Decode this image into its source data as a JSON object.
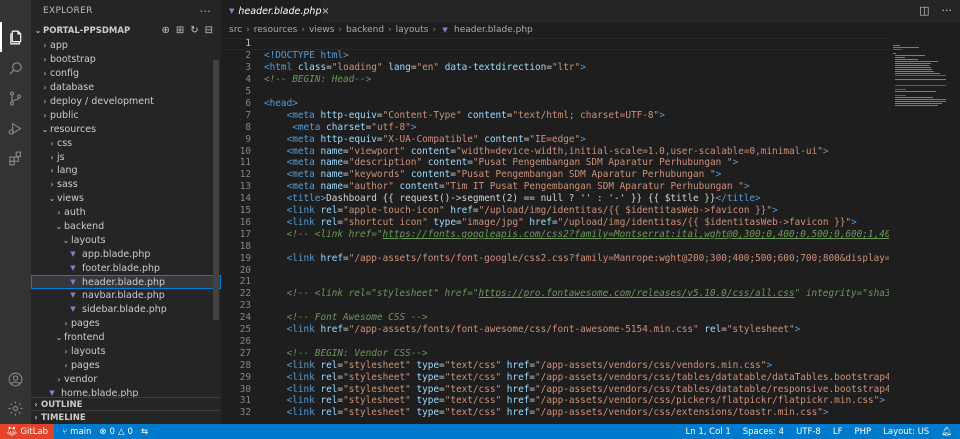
{
  "activity": {
    "items": [
      "files-icon",
      "search-icon",
      "source-control-icon",
      "run-debug-icon",
      "extensions-icon"
    ],
    "bottom": [
      "account-icon",
      "settings-gear-icon"
    ]
  },
  "sidebar": {
    "title": "EXPLORER",
    "project": "PORTAL-PPSDMAP",
    "tree": [
      {
        "label": "app",
        "depth": 1,
        "type": "folder",
        "open": false
      },
      {
        "label": "bootstrap",
        "depth": 1,
        "type": "folder",
        "open": false
      },
      {
        "label": "config",
        "depth": 1,
        "type": "folder",
        "open": false
      },
      {
        "label": "database",
        "depth": 1,
        "type": "folder",
        "open": false
      },
      {
        "label": "deploy / development",
        "depth": 1,
        "type": "folder",
        "open": false
      },
      {
        "label": "public",
        "depth": 1,
        "type": "folder",
        "open": false
      },
      {
        "label": "resources",
        "depth": 1,
        "type": "folder",
        "open": true
      },
      {
        "label": "css",
        "depth": 2,
        "type": "folder",
        "open": false
      },
      {
        "label": "js",
        "depth": 2,
        "type": "folder",
        "open": false
      },
      {
        "label": "lang",
        "depth": 2,
        "type": "folder",
        "open": false
      },
      {
        "label": "sass",
        "depth": 2,
        "type": "folder",
        "open": false
      },
      {
        "label": "views",
        "depth": 2,
        "type": "folder",
        "open": true
      },
      {
        "label": "auth",
        "depth": 3,
        "type": "folder",
        "open": false
      },
      {
        "label": "backend",
        "depth": 3,
        "type": "folder",
        "open": true
      },
      {
        "label": "layouts",
        "depth": 4,
        "type": "folder",
        "open": true
      },
      {
        "label": "app.blade.php",
        "depth": 5,
        "type": "file"
      },
      {
        "label": "footer.blade.php",
        "depth": 5,
        "type": "file"
      },
      {
        "label": "header.blade.php",
        "depth": 5,
        "type": "file",
        "selected": true
      },
      {
        "label": "navbar.blade.php",
        "depth": 5,
        "type": "file"
      },
      {
        "label": "sidebar.blade.php",
        "depth": 5,
        "type": "file"
      },
      {
        "label": "pages",
        "depth": 4,
        "type": "folder",
        "open": false
      },
      {
        "label": "frontend",
        "depth": 3,
        "type": "folder",
        "open": true
      },
      {
        "label": "layouts",
        "depth": 4,
        "type": "folder",
        "open": false
      },
      {
        "label": "pages",
        "depth": 4,
        "type": "folder",
        "open": false
      },
      {
        "label": "vendor",
        "depth": 3,
        "type": "folder",
        "open": false
      },
      {
        "label": "home.blade.php",
        "depth": 2,
        "type": "file"
      }
    ],
    "outline": "OUTLINE",
    "timeline": "TIMELINE"
  },
  "tab": {
    "label": "header.blade.php",
    "close": "×"
  },
  "breadcrumb": [
    "src",
    "resources",
    "views",
    "backend",
    "layouts",
    "header.blade.php"
  ],
  "lines": [
    {
      "n": "1",
      "t": [
        [
          "",
          ""
        ]
      ]
    },
    {
      "n": "2",
      "t": [
        [
          "c-doc",
          "<!DOCTYPE html>"
        ]
      ]
    },
    {
      "n": "3",
      "t": [
        [
          "c-tag",
          "<html"
        ],
        [
          "",
          " "
        ],
        [
          "c-attr",
          "class"
        ],
        [
          "",
          "="
        ],
        [
          "c-str",
          "\"loading\""
        ],
        [
          "",
          " "
        ],
        [
          "c-attr",
          "lang"
        ],
        [
          "",
          "="
        ],
        [
          "c-str",
          "\"en\""
        ],
        [
          "",
          " "
        ],
        [
          "c-attr",
          "data-textdirection"
        ],
        [
          "",
          "="
        ],
        [
          "c-str",
          "\"ltr\""
        ],
        [
          "c-tag",
          ">"
        ]
      ]
    },
    {
      "n": "4",
      "t": [
        [
          "c-com",
          "<!-- BEGIN: Head-->"
        ]
      ]
    },
    {
      "n": "5",
      "t": [
        [
          "",
          ""
        ]
      ]
    },
    {
      "n": "6",
      "t": [
        [
          "c-tag",
          "<head>"
        ]
      ]
    },
    {
      "n": "7",
      "t": [
        [
          "",
          "    "
        ],
        [
          "c-tag",
          "<meta"
        ],
        [
          "",
          " "
        ],
        [
          "c-attr",
          "http-equiv"
        ],
        [
          "",
          "="
        ],
        [
          "c-str",
          "\"Content-Type\""
        ],
        [
          "",
          " "
        ],
        [
          "c-attr",
          "content"
        ],
        [
          "",
          "="
        ],
        [
          "c-str",
          "\"text/html; charset=UTF-8\""
        ],
        [
          "c-tag",
          ">"
        ]
      ]
    },
    {
      "n": "8",
      "t": [
        [
          "",
          "     "
        ],
        [
          "c-tag",
          "<meta"
        ],
        [
          "",
          " "
        ],
        [
          "c-attr",
          "charset"
        ],
        [
          "",
          "="
        ],
        [
          "c-str",
          "\"utf-8\""
        ],
        [
          "c-tag",
          ">"
        ]
      ]
    },
    {
      "n": "9",
      "t": [
        [
          "",
          "    "
        ],
        [
          "c-tag",
          "<meta"
        ],
        [
          "",
          " "
        ],
        [
          "c-attr",
          "http-equiv"
        ],
        [
          "",
          "="
        ],
        [
          "c-str",
          "\"X-UA-Compatible\""
        ],
        [
          "",
          " "
        ],
        [
          "c-attr",
          "content"
        ],
        [
          "",
          "="
        ],
        [
          "c-str",
          "\"IE=edge\""
        ],
        [
          "c-tag",
          ">"
        ]
      ]
    },
    {
      "n": "10",
      "t": [
        [
          "",
          "    "
        ],
        [
          "c-tag",
          "<meta"
        ],
        [
          "",
          " "
        ],
        [
          "c-attr",
          "name"
        ],
        [
          "",
          "="
        ],
        [
          "c-str",
          "\"viewport\""
        ],
        [
          "",
          " "
        ],
        [
          "c-attr",
          "content"
        ],
        [
          "",
          "="
        ],
        [
          "c-str",
          "\"width=device-width,initial-scale=1.0,user-scalable=0,minimal-ui\""
        ],
        [
          "c-tag",
          ">"
        ]
      ]
    },
    {
      "n": "11",
      "t": [
        [
          "",
          "    "
        ],
        [
          "c-tag",
          "<meta"
        ],
        [
          "",
          " "
        ],
        [
          "c-attr",
          "name"
        ],
        [
          "",
          "="
        ],
        [
          "c-str",
          "\"description\""
        ],
        [
          "",
          " "
        ],
        [
          "c-attr",
          "content"
        ],
        [
          "",
          "="
        ],
        [
          "c-str",
          "\"Pusat Pengembangan SDM Aparatur Perhubungan \""
        ],
        [
          "c-tag",
          ">"
        ]
      ]
    },
    {
      "n": "12",
      "t": [
        [
          "",
          "    "
        ],
        [
          "c-tag",
          "<meta"
        ],
        [
          "",
          " "
        ],
        [
          "c-attr",
          "name"
        ],
        [
          "",
          "="
        ],
        [
          "c-str",
          "\"keywords\""
        ],
        [
          "",
          " "
        ],
        [
          "c-attr",
          "content"
        ],
        [
          "",
          "="
        ],
        [
          "c-str",
          "\"Pusat Pengembangan SDM Aparatur Perhubungan \""
        ],
        [
          "c-tag",
          ">"
        ]
      ]
    },
    {
      "n": "13",
      "t": [
        [
          "",
          "    "
        ],
        [
          "c-tag",
          "<meta"
        ],
        [
          "",
          " "
        ],
        [
          "c-attr",
          "name"
        ],
        [
          "",
          "="
        ],
        [
          "c-str",
          "\"author\""
        ],
        [
          "",
          " "
        ],
        [
          "c-attr",
          "content"
        ],
        [
          "",
          "="
        ],
        [
          "c-str",
          "\"Tim IT Pusat Pengembangan SDM Aparatur Perhubungan \""
        ],
        [
          "c-tag",
          ">"
        ]
      ]
    },
    {
      "n": "14",
      "t": [
        [
          "",
          "    "
        ],
        [
          "c-tag",
          "<title>"
        ],
        [
          "",
          "Dashboard {{ request()->segment(2) == null ? '' : '-' }} {{ $title }}"
        ],
        [
          "c-tag",
          "</title>"
        ]
      ]
    },
    {
      "n": "15",
      "t": [
        [
          "",
          "    "
        ],
        [
          "c-tag",
          "<link"
        ],
        [
          "",
          " "
        ],
        [
          "c-attr",
          "rel"
        ],
        [
          "",
          "="
        ],
        [
          "c-str",
          "\"apple-touch-icon\""
        ],
        [
          "",
          " "
        ],
        [
          "c-attr",
          "href"
        ],
        [
          "",
          "="
        ],
        [
          "c-str",
          "\"/upload/img/identitas/{{ $identitasWeb->favicon }}\""
        ],
        [
          "c-tag",
          ">"
        ]
      ]
    },
    {
      "n": "16",
      "t": [
        [
          "",
          "    "
        ],
        [
          "c-tag",
          "<link"
        ],
        [
          "",
          " "
        ],
        [
          "c-attr",
          "rel"
        ],
        [
          "",
          "="
        ],
        [
          "c-str",
          "\"shortcut icon\""
        ],
        [
          "",
          " "
        ],
        [
          "c-attr",
          "type"
        ],
        [
          "",
          "="
        ],
        [
          "c-str",
          "\"image/jpg\""
        ],
        [
          "",
          " "
        ],
        [
          "c-attr",
          "href"
        ],
        [
          "",
          "="
        ],
        [
          "c-str",
          "\"/upload/img/identitas/{{ $identitasWeb->favicon }}\""
        ],
        [
          "c-tag",
          ">"
        ]
      ]
    },
    {
      "n": "17",
      "t": [
        [
          "",
          "    "
        ],
        [
          "c-com",
          "<!-- <link href=\""
        ],
        [
          "c-link",
          "https://fonts.googleapis.com/css2?family=Montserrat:ital,wght@0,300;0,400;0,500;0,600;1,400;1,500"
        ]
      ]
    },
    {
      "n": "18",
      "t": [
        [
          "",
          ""
        ]
      ]
    },
    {
      "n": "19",
      "t": [
        [
          "",
          "    "
        ],
        [
          "c-tag",
          "<link"
        ],
        [
          "",
          " "
        ],
        [
          "c-attr",
          "href"
        ],
        [
          "",
          "="
        ],
        [
          "c-str",
          "\"/app-assets/fonts/font-google/css2.css?family=Manrope:wght@200;300;400;500;600;700;800&display=swap\""
        ],
        [
          "",
          " r"
        ]
      ]
    },
    {
      "n": "20",
      "t": [
        [
          "",
          ""
        ]
      ]
    },
    {
      "n": "21",
      "t": [
        [
          "",
          ""
        ]
      ]
    },
    {
      "n": "22",
      "t": [
        [
          "",
          "    "
        ],
        [
          "c-com",
          "<!-- <link rel=\"stylesheet\" href=\""
        ],
        [
          "c-link",
          "https://pro.fontawesome.com/releases/v5.10.0/css/all.css"
        ],
        [
          "c-com",
          "\" integrity=\"sha384-AYmE"
        ]
      ]
    },
    {
      "n": "23",
      "t": [
        [
          "",
          ""
        ]
      ]
    },
    {
      "n": "24",
      "t": [
        [
          "",
          "    "
        ],
        [
          "c-com",
          "<!-- Font Awesome CSS -->"
        ]
      ]
    },
    {
      "n": "25",
      "t": [
        [
          "",
          "    "
        ],
        [
          "c-tag",
          "<link"
        ],
        [
          "",
          " "
        ],
        [
          "c-attr",
          "href"
        ],
        [
          "",
          "="
        ],
        [
          "c-str",
          "\"/app-assets/fonts/font-awesome/css/font-awesome-5154.min.css\""
        ],
        [
          "",
          " "
        ],
        [
          "c-attr",
          "rel"
        ],
        [
          "",
          "="
        ],
        [
          "c-str",
          "\"stylesheet\""
        ],
        [
          "c-tag",
          ">"
        ]
      ]
    },
    {
      "n": "26",
      "t": [
        [
          "",
          ""
        ]
      ]
    },
    {
      "n": "27",
      "t": [
        [
          "",
          "    "
        ],
        [
          "c-com",
          "<!-- BEGIN: Vendor CSS-->"
        ]
      ]
    },
    {
      "n": "28",
      "t": [
        [
          "",
          "    "
        ],
        [
          "c-tag",
          "<link"
        ],
        [
          "",
          " "
        ],
        [
          "c-attr",
          "rel"
        ],
        [
          "",
          "="
        ],
        [
          "c-str",
          "\"stylesheet\""
        ],
        [
          "",
          " "
        ],
        [
          "c-attr",
          "type"
        ],
        [
          "",
          "="
        ],
        [
          "c-str",
          "\"text/css\""
        ],
        [
          "",
          " "
        ],
        [
          "c-attr",
          "href"
        ],
        [
          "",
          "="
        ],
        [
          "c-str",
          "\"/app-assets/vendors/css/vendors.min.css\""
        ],
        [
          "c-tag",
          ">"
        ]
      ]
    },
    {
      "n": "29",
      "t": [
        [
          "",
          "    "
        ],
        [
          "c-tag",
          "<link"
        ],
        [
          "",
          " "
        ],
        [
          "c-attr",
          "rel"
        ],
        [
          "",
          "="
        ],
        [
          "c-str",
          "\"stylesheet\""
        ],
        [
          "",
          " "
        ],
        [
          "c-attr",
          "type"
        ],
        [
          "",
          "="
        ],
        [
          "c-str",
          "\"text/css\""
        ],
        [
          "",
          " "
        ],
        [
          "c-attr",
          "href"
        ],
        [
          "",
          "="
        ],
        [
          "c-str",
          "\"/app-assets/vendors/css/tables/datatable/dataTables.bootstrap4.min.css"
        ]
      ]
    },
    {
      "n": "30",
      "t": [
        [
          "",
          "    "
        ],
        [
          "c-tag",
          "<link"
        ],
        [
          "",
          " "
        ],
        [
          "c-attr",
          "rel"
        ],
        [
          "",
          "="
        ],
        [
          "c-str",
          "\"stylesheet\""
        ],
        [
          "",
          " "
        ],
        [
          "c-attr",
          "type"
        ],
        [
          "",
          "="
        ],
        [
          "c-str",
          "\"text/css\""
        ],
        [
          "",
          " "
        ],
        [
          "c-attr",
          "href"
        ],
        [
          "",
          "="
        ],
        [
          "c-str",
          "\"/app-assets/vendors/css/tables/datatable/responsive.bootstrap4.min.cs"
        ]
      ]
    },
    {
      "n": "31",
      "t": [
        [
          "",
          "    "
        ],
        [
          "c-tag",
          "<link"
        ],
        [
          "",
          " "
        ],
        [
          "c-attr",
          "rel"
        ],
        [
          "",
          "="
        ],
        [
          "c-str",
          "\"stylesheet\""
        ],
        [
          "",
          " "
        ],
        [
          "c-attr",
          "type"
        ],
        [
          "",
          "="
        ],
        [
          "c-str",
          "\"text/css\""
        ],
        [
          "",
          " "
        ],
        [
          "c-attr",
          "href"
        ],
        [
          "",
          "="
        ],
        [
          "c-str",
          "\"/app-assets/vendors/css/pickers/flatpickr/flatpickr.min.css\""
        ],
        [
          "c-tag",
          ">"
        ]
      ]
    },
    {
      "n": "32",
      "t": [
        [
          "",
          "    "
        ],
        [
          "c-tag",
          "<link"
        ],
        [
          "",
          " "
        ],
        [
          "c-attr",
          "rel"
        ],
        [
          "",
          "="
        ],
        [
          "c-str",
          "\"stylesheet\""
        ],
        [
          "",
          " "
        ],
        [
          "c-attr",
          "type"
        ],
        [
          "",
          "="
        ],
        [
          "c-str",
          "\"text/css\""
        ],
        [
          "",
          " "
        ],
        [
          "c-attr",
          "href"
        ],
        [
          "",
          "="
        ],
        [
          "c-str",
          "\"/app-assets/vendors/css/extensions/toastr.min.css\""
        ],
        [
          "c-tag",
          ">"
        ]
      ]
    }
  ],
  "status": {
    "gitlab": "GitLab",
    "branch": "main",
    "problems": "0",
    "warnings": "0",
    "position": "Ln 1, Col 1",
    "spaces": "Spaces: 4",
    "encoding": "UTF-8",
    "eol": "LF",
    "language": "PHP",
    "layout": "Layout: US"
  },
  "colors": {
    "accent": "#007acc",
    "gitlab": "#e24329",
    "selection_outline": "#007fd4"
  }
}
